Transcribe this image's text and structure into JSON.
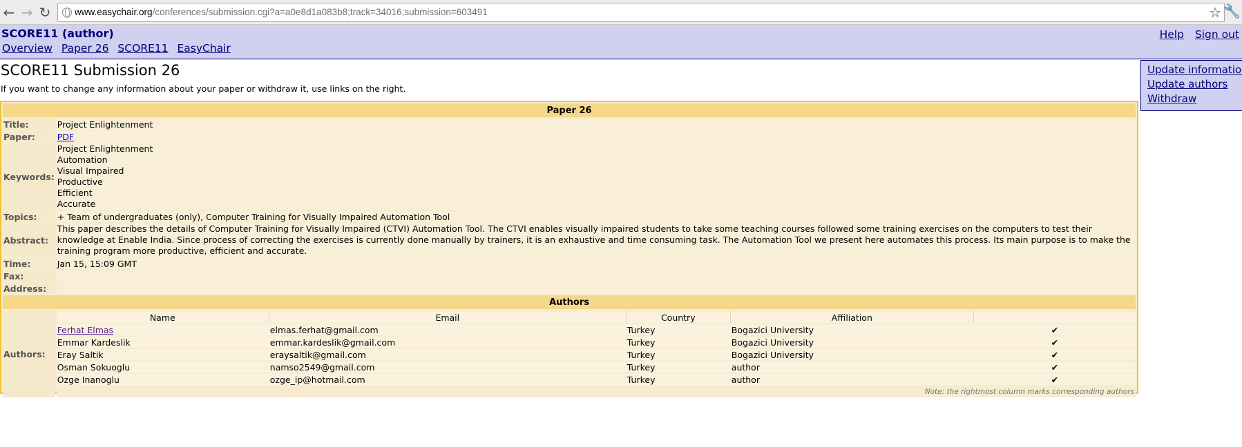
{
  "browser": {
    "back_glyph": "←",
    "forward_glyph": "→",
    "reload_glyph": "↻",
    "url_host": "www.easychair.org",
    "url_path": "/conferences/submission.cgi?a=a0e8d1a083b8;track=34016;submission=603491",
    "star_glyph": "☆",
    "wrench_glyph": "🔧"
  },
  "header": {
    "title": "SCORE11 (author)",
    "menu": [
      "Overview",
      "Paper 26",
      "SCORE11",
      "EasyChair"
    ],
    "help": "Help",
    "sign_out": "Sign out"
  },
  "page": {
    "title": "SCORE11 Submission 26",
    "intro": "If you want to change any information about your paper or withdraw it, use links on the right."
  },
  "actions": [
    "Update information",
    "Update authors",
    "Withdraw"
  ],
  "paper": {
    "heading": "Paper 26",
    "labels": {
      "title": "Title:",
      "paper": "Paper:",
      "keywords": "Keywords:",
      "topics": "Topics:",
      "abstract": "Abstract:",
      "time": "Time:",
      "fax": "Fax:",
      "address": "Address:",
      "authors": "Authors:"
    },
    "title": "Project Enlightenment",
    "paper_link": "PDF",
    "keywords": [
      "Project Enlightenment",
      "Automation",
      "Visual Impaired",
      "Productive",
      "Efficient",
      "Accurate"
    ],
    "topics": "+ Team of undergraduates (only), Computer Training for Visually Impaired Automation Tool",
    "abstract": "This paper describes the details of Computer Training for Visually Impaired (CTVI) Automation Tool. The CTVI enables visually impaired students to take some teaching courses followed some training exercises on the computers to test their knowledge at Enable India. Since process of correcting the exercises is currently done manually by trainers, it is an exhaustive and time consuming task. The Automation Tool we present here automates this process. Its main purpose is to make the training program more productive, efficient and accurate.",
    "time": "Jan 15, 15:09 GMT",
    "fax": "",
    "address": ""
  },
  "authors": {
    "heading": "Authors",
    "columns": [
      "Name",
      "Email",
      "Country",
      "Affiliation",
      ""
    ],
    "rows": [
      {
        "name": "Ferhat Elmas",
        "email": "elmas.ferhat@gmail.com",
        "country": "Turkey",
        "affiliation": "Bogazici University",
        "corresponding": "✔"
      },
      {
        "name": "Emmar Kardeslik",
        "email": "emmar.kardeslik@gmail.com",
        "country": "Turkey",
        "affiliation": "Bogazici University",
        "corresponding": "✔"
      },
      {
        "name": "Eray Saltik",
        "email": "eraysaltik@gmail.com",
        "country": "Turkey",
        "affiliation": "Bogazici University",
        "corresponding": "✔"
      },
      {
        "name": "Osman Sokuoglu",
        "email": "namso2549@gmail.com",
        "country": "Turkey",
        "affiliation": "author",
        "corresponding": "✔"
      },
      {
        "name": "Ozge Inanoglu",
        "email": "ozge_ip@hotmail.com",
        "country": "Turkey",
        "affiliation": "author",
        "corresponding": "✔"
      }
    ],
    "note": "Note: the rightmost column marks corresponding authors"
  }
}
